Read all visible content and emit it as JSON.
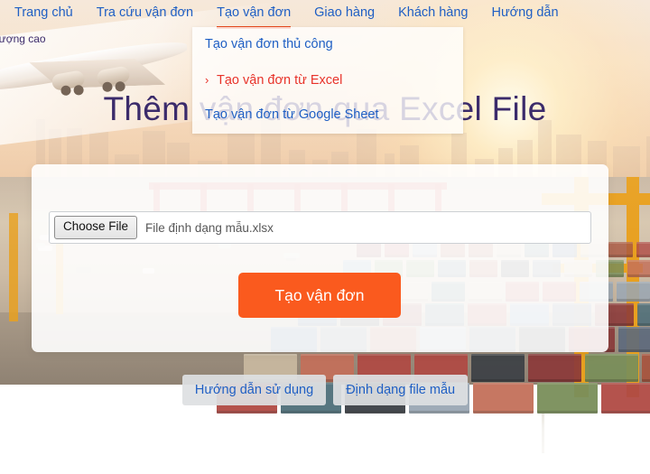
{
  "nav": {
    "items": [
      {
        "label": "Trang chủ",
        "active": false
      },
      {
        "label": "Tra cứu vận đơn",
        "active": false
      },
      {
        "label": "Tạo vận đơn",
        "active": true
      },
      {
        "label": "Giao hàng",
        "active": false
      },
      {
        "label": "Khách hàng",
        "active": false
      },
      {
        "label": "Hướng dẫn",
        "active": false
      }
    ]
  },
  "dropdown": {
    "items": [
      {
        "label": "Tạo vận đơn thủ công",
        "current": false,
        "chevron": ""
      },
      {
        "label": "Tạo vận đơn từ Excel",
        "current": true,
        "chevron": "›"
      },
      {
        "label": "Tạo vận đơn từ Google Sheet",
        "current": false,
        "chevron": ""
      }
    ]
  },
  "hero": {
    "title": "Thêm vận đơn qua Excel File",
    "left_label": "lượng cao"
  },
  "card": {
    "choose_file_label": "Choose File",
    "file_name": "File định dạng mẫu.xlsx",
    "submit_label": "Tạo vận đơn"
  },
  "help": {
    "buttons": [
      {
        "label": "Hướng dẫn sử dụng"
      },
      {
        "label": "Định dạng file mẫu"
      }
    ]
  },
  "colors": {
    "accent_orange": "#fa5a1e",
    "nav_blue": "#1f5fc4",
    "active_underline": "#e8491d",
    "heading_purple": "#3b2b6b",
    "current_red": "#e8332a",
    "help_btn_bg": "#dee0e2"
  }
}
